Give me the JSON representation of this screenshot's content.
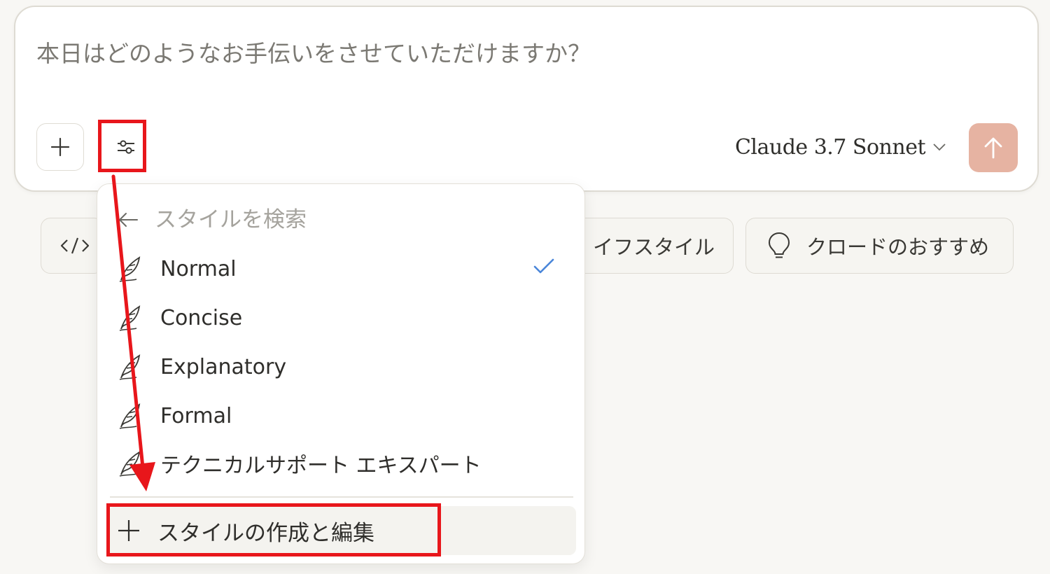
{
  "composer": {
    "placeholder": "本日はどのようなお手伝いをさせていただけますか？",
    "model_name": "Claude 3.7 Sonnet"
  },
  "suggestions": [
    {
      "label": "",
      "icon": "code-icon"
    },
    {
      "label": "イフスタイル"
    },
    {
      "label": "クロードのおすすめ",
      "icon": "lightbulb-icon"
    }
  ],
  "style_menu": {
    "search_placeholder": "スタイルを検索",
    "items": [
      {
        "label": "Normal",
        "selected": true
      },
      {
        "label": "Concise",
        "selected": false
      },
      {
        "label": "Explanatory",
        "selected": false
      },
      {
        "label": "Formal",
        "selected": false
      },
      {
        "label": "テクニカルサポート エキスパート",
        "selected": false
      }
    ],
    "create_label": "スタイルの作成と編集"
  },
  "colors": {
    "background": "#f8f7f4",
    "send_button": "#e6b3a2",
    "check": "#4a86d9",
    "annotation_red": "#e8161b"
  }
}
